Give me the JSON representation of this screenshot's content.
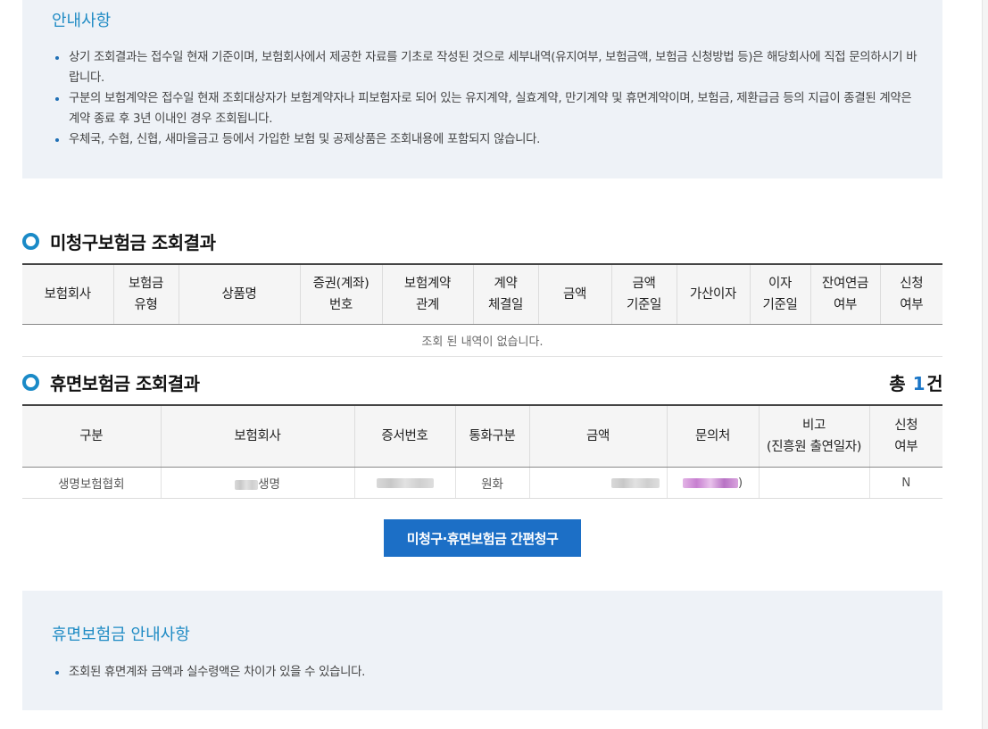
{
  "notice": {
    "title": "안내사항",
    "items": [
      "상기 조회결과는 접수일 현재 기준이며, 보험회사에서 제공한 자료를 기초로 작성된 것으로 세부내역(유지여부, 보험금액, 보험금 신청방법 등)은 해당회사에 직접 문의하시기 바랍니다.",
      "구분의 보험계약은 접수일 현재 조회대상자가 보험계약자나 피보험자로 되어 있는 유지계약, 실효계약, 만기계약 및 휴면계약이며, 보험금, 제환급금 등의 지급이 종결된 계약은 계약 종료 후 3년 이내인 경우 조회됩니다.",
      "우체국, 수협, 신협, 새마을금고 등에서 가입한 보험 및 공제상품은 조회내용에 포함되지 않습니다."
    ]
  },
  "unclaimed": {
    "title": "미청구보험금 조회결과",
    "columns": [
      {
        "l1": "보험회사",
        "l2": ""
      },
      {
        "l1": "보험금",
        "l2": "유형"
      },
      {
        "l1": "상품명",
        "l2": ""
      },
      {
        "l1": "증권(계좌)",
        "l2": "번호"
      },
      {
        "l1": "보험계약",
        "l2": "관계"
      },
      {
        "l1": "계약",
        "l2": "체결일"
      },
      {
        "l1": "금액",
        "l2": ""
      },
      {
        "l1": "금액",
        "l2": "기준일"
      },
      {
        "l1": "가산이자",
        "l2": ""
      },
      {
        "l1": "이자",
        "l2": "기준일"
      },
      {
        "l1": "잔여연금",
        "l2": "여부"
      },
      {
        "l1": "신청",
        "l2": "여부"
      }
    ],
    "empty_message": "조회 된 내역이 없습니다."
  },
  "dormant": {
    "title": "휴면보험금 조회결과",
    "total_prefix": "총",
    "total_count": "1",
    "total_suffix": "건",
    "columns": [
      {
        "l1": "구분",
        "l2": ""
      },
      {
        "l1": "보험회사",
        "l2": ""
      },
      {
        "l1": "증서번호",
        "l2": ""
      },
      {
        "l1": "통화구분",
        "l2": ""
      },
      {
        "l1": "금액",
        "l2": ""
      },
      {
        "l1": "문의처",
        "l2": ""
      },
      {
        "l1": "비고",
        "l2": "(진흥원 출연일자)"
      },
      {
        "l1": "신청",
        "l2": "여부"
      }
    ],
    "rows": [
      {
        "category": "생명보험협회",
        "company_suffix": "생명",
        "certificate_no": "",
        "currency": "원화",
        "amount": "",
        "contact_suffix": ")",
        "note": "",
        "applied": "N"
      }
    ]
  },
  "claim_button": {
    "label": "미청구·휴면보험금 간편청구"
  },
  "dormant_notice": {
    "title": "휴면보험금 안내사항",
    "items": [
      "조회된 휴면계좌 금액과 실수령액은 차이가 있을 수 있습니다."
    ]
  },
  "colors": {
    "accent": "#1f8bc4",
    "button": "#1c6fc6",
    "notice_bg": "#eef2f7",
    "total_count": "#1a76c7"
  }
}
